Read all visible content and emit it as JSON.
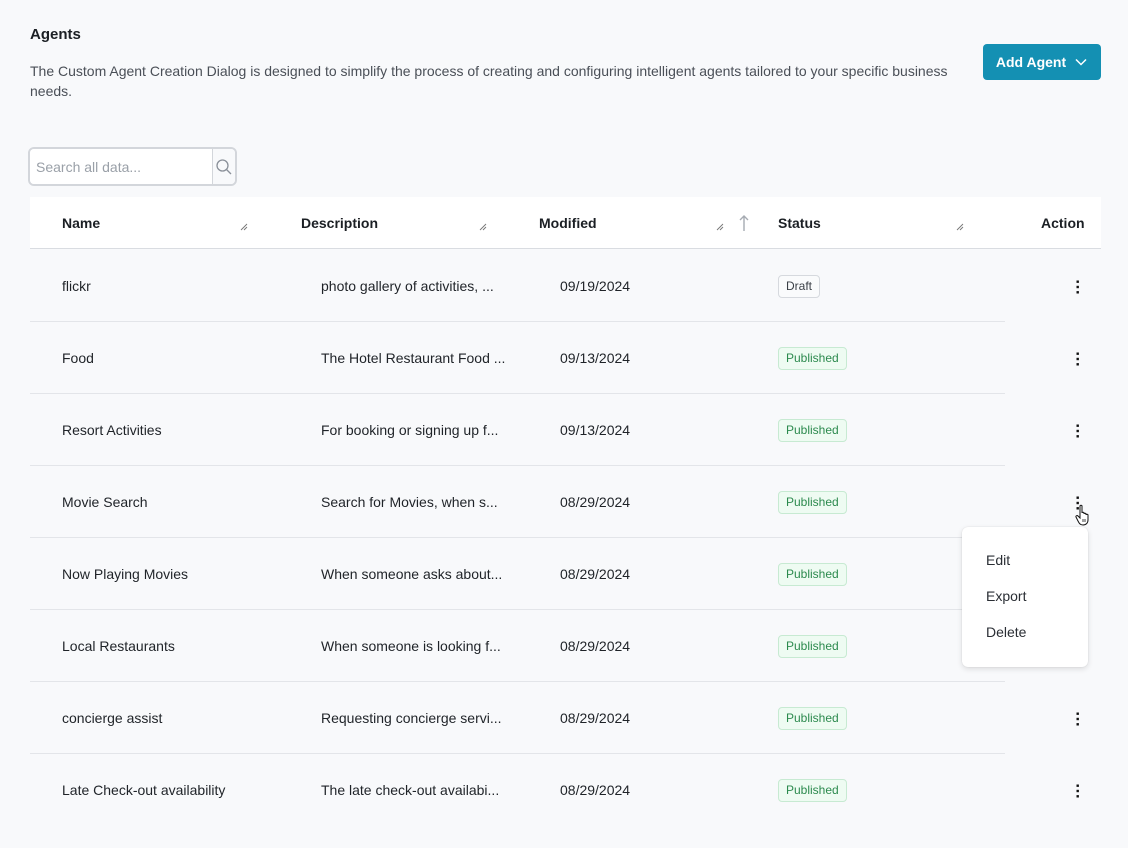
{
  "header": {
    "title": "Agents",
    "description": "The Custom Agent Creation Dialog is designed to simplify the process of creating and configuring intelligent agents tailored to your specific business needs.",
    "add_button_label": "Add Agent",
    "add_button_icon": "chevron-down-icon",
    "accent_color": "#1490b3"
  },
  "search": {
    "placeholder": "Search all data...",
    "value": "",
    "icon": "search-icon"
  },
  "table": {
    "columns": [
      {
        "label": "Name"
      },
      {
        "label": "Description"
      },
      {
        "label": "Modified",
        "sort": "ascending"
      },
      {
        "label": "Status"
      },
      {
        "label": "Action"
      }
    ],
    "rows": [
      {
        "name": "flickr",
        "description": "photo gallery of activities, ...",
        "modified": "09/19/2024",
        "status": "Draft"
      },
      {
        "name": "Food",
        "description": "The Hotel Restaurant Food ...",
        "modified": "09/13/2024",
        "status": "Published"
      },
      {
        "name": "Resort Activities",
        "description": "For booking or signing up f...",
        "modified": "09/13/2024",
        "status": "Published"
      },
      {
        "name": "Movie Search",
        "description": "Search for Movies, when s...",
        "modified": "08/29/2024",
        "status": "Published"
      },
      {
        "name": "Now Playing Movies",
        "description": "When someone asks about...",
        "modified": "08/29/2024",
        "status": "Published"
      },
      {
        "name": "Local Restaurants",
        "description": "When someone is looking f...",
        "modified": "08/29/2024",
        "status": "Published"
      },
      {
        "name": "concierge assist",
        "description": "Requesting concierge servi...",
        "modified": "08/29/2024",
        "status": "Published"
      },
      {
        "name": "Late Check-out availability",
        "description": "The late check-out availabi...",
        "modified": "08/29/2024",
        "status": "Published"
      }
    ],
    "status_colors": {
      "Draft": "#3a3f46",
      "Published": "#2c8a4e"
    }
  },
  "action_menu": {
    "open_for_row": 3,
    "items": [
      {
        "label": "Edit"
      },
      {
        "label": "Export"
      },
      {
        "label": "Delete"
      }
    ]
  }
}
